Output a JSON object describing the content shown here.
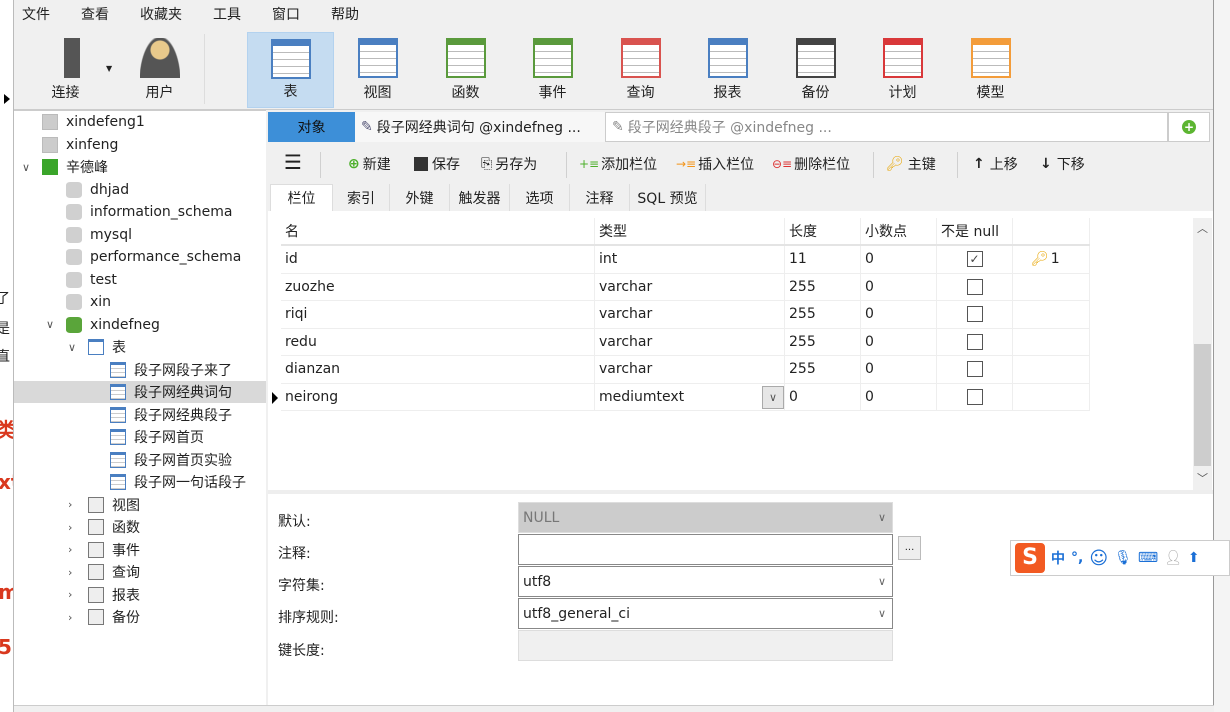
{
  "background_fragments": [
    "了",
    "是",
    "直",
    "类",
    "xt",
    "m",
    "5"
  ],
  "menu": [
    "文件",
    "查看",
    "收藏夹",
    "工具",
    "窗口",
    "帮助"
  ],
  "toolbar": [
    {
      "label": "连接",
      "icon": "connection-icon"
    },
    {
      "label": "用户",
      "icon": "user-icon"
    },
    {
      "label": "表",
      "icon": "table-icon",
      "active": true
    },
    {
      "label": "视图",
      "icon": "view-icon"
    },
    {
      "label": "函数",
      "icon": "function-icon"
    },
    {
      "label": "事件",
      "icon": "event-icon"
    },
    {
      "label": "查询",
      "icon": "query-icon"
    },
    {
      "label": "报表",
      "icon": "report-icon"
    },
    {
      "label": "备份",
      "icon": "backup-icon"
    },
    {
      "label": "计划",
      "icon": "schedule-icon"
    },
    {
      "label": "模型",
      "icon": "model-icon"
    }
  ],
  "sidebar": {
    "connections": [
      "xindefeng1",
      "xinfeng",
      "辛德峰"
    ],
    "databases": [
      "dhjad",
      "information_schema",
      "mysql",
      "performance_schema",
      "test",
      "xin",
      "xindefneg"
    ],
    "tables_label": "表",
    "tables": [
      "段子网段子来了",
      "段子网经典词句",
      "段子网经典段子",
      "段子网首页",
      "段子网首页实验",
      "段子网一句话段子"
    ],
    "selected_table": "段子网经典词句",
    "groups": [
      "视图",
      "函数",
      "事件",
      "查询",
      "报表",
      "备份"
    ]
  },
  "tabs": {
    "objects": "对象",
    "tab1": "段子网经典词句 @xindefneg ...",
    "tab2": "段子网经典段子 @xindefneg ..."
  },
  "actions": {
    "new": "新建",
    "save": "保存",
    "save_as": "另存为",
    "add_field": "添加栏位",
    "insert_field": "插入栏位",
    "delete_field": "删除栏位",
    "primary_key": "主键",
    "move_up": "上移",
    "move_down": "下移"
  },
  "subtabs": [
    "栏位",
    "索引",
    "外键",
    "触发器",
    "选项",
    "注释",
    "SQL 预览"
  ],
  "grid": {
    "headers": [
      "名",
      "类型",
      "长度",
      "小数点",
      "不是 null",
      ""
    ],
    "rows": [
      {
        "name": "id",
        "type": "int",
        "length": "11",
        "decimals": "0",
        "not_null": true,
        "key": "1"
      },
      {
        "name": "zuozhe",
        "type": "varchar",
        "length": "255",
        "decimals": "0",
        "not_null": false,
        "key": ""
      },
      {
        "name": "riqi",
        "type": "varchar",
        "length": "255",
        "decimals": "0",
        "not_null": false,
        "key": ""
      },
      {
        "name": "redu",
        "type": "varchar",
        "length": "255",
        "decimals": "0",
        "not_null": false,
        "key": ""
      },
      {
        "name": "dianzan",
        "type": "varchar",
        "length": "255",
        "decimals": "0",
        "not_null": false,
        "key": ""
      },
      {
        "name": "neirong",
        "type": "mediumtext",
        "length": "0",
        "decimals": "0",
        "not_null": false,
        "key": "",
        "current": true
      }
    ]
  },
  "props": {
    "default_label": "默认:",
    "default_value": "NULL",
    "comment_label": "注释:",
    "comment_value": "",
    "comment_button": "...",
    "charset_label": "字符集:",
    "charset_value": "utf8",
    "collation_label": "排序规则:",
    "collation_value": "utf8_general_ci",
    "keylen_label": "键长度:",
    "keylen_value": ""
  },
  "ime": {
    "mode": "中",
    "punct": "°,"
  }
}
